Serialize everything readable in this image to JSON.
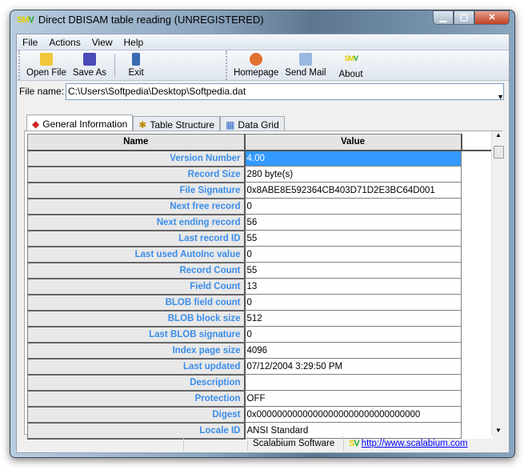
{
  "window": {
    "title": "Direct DBISAM table reading (UNREGISTERED)",
    "min": "▁",
    "max": "▢",
    "close": "✕"
  },
  "menu": [
    "File",
    "Actions",
    "View",
    "Help"
  ],
  "toolbar": {
    "open": "Open File",
    "save": "Save As",
    "exit": "Exit",
    "homepage": "Homepage",
    "mail": "Send Mail",
    "about": "About"
  },
  "file": {
    "label": "File name:",
    "value": "C:\\Users\\Softpedia\\Desktop\\Softpedia.dat"
  },
  "tabs": [
    "General Information",
    "Table Structure",
    "Data Grid"
  ],
  "grid": {
    "headers": [
      "Name",
      "Value"
    ],
    "rows": [
      [
        "Version Number",
        "4.00"
      ],
      [
        "Record Size",
        "280 byte(s)"
      ],
      [
        "File Signature",
        "0x8ABE8E592364CB403D71D2E3BC64D001"
      ],
      [
        "Next free record",
        "0"
      ],
      [
        "Next ending record",
        "56"
      ],
      [
        "Last record ID",
        "55"
      ],
      [
        "Last used AutoInc value",
        "0"
      ],
      [
        "Record Count",
        "55"
      ],
      [
        "Field Count",
        "13"
      ],
      [
        "BLOB field count",
        "0"
      ],
      [
        "BLOB block size",
        "512"
      ],
      [
        "Last BLOB signature",
        "0"
      ],
      [
        "Index page size",
        "4096"
      ],
      [
        "Last updated",
        "07/12/2004 3:29:50 PM"
      ],
      [
        "Description",
        ""
      ],
      [
        "Protection",
        "OFF"
      ],
      [
        "Digest",
        "0x00000000000000000000000000000000"
      ],
      [
        "Locale ID",
        "ANSI Standard"
      ]
    ]
  },
  "status": {
    "company": "Scalabium Software",
    "url": "http://www.scalabium.com"
  }
}
